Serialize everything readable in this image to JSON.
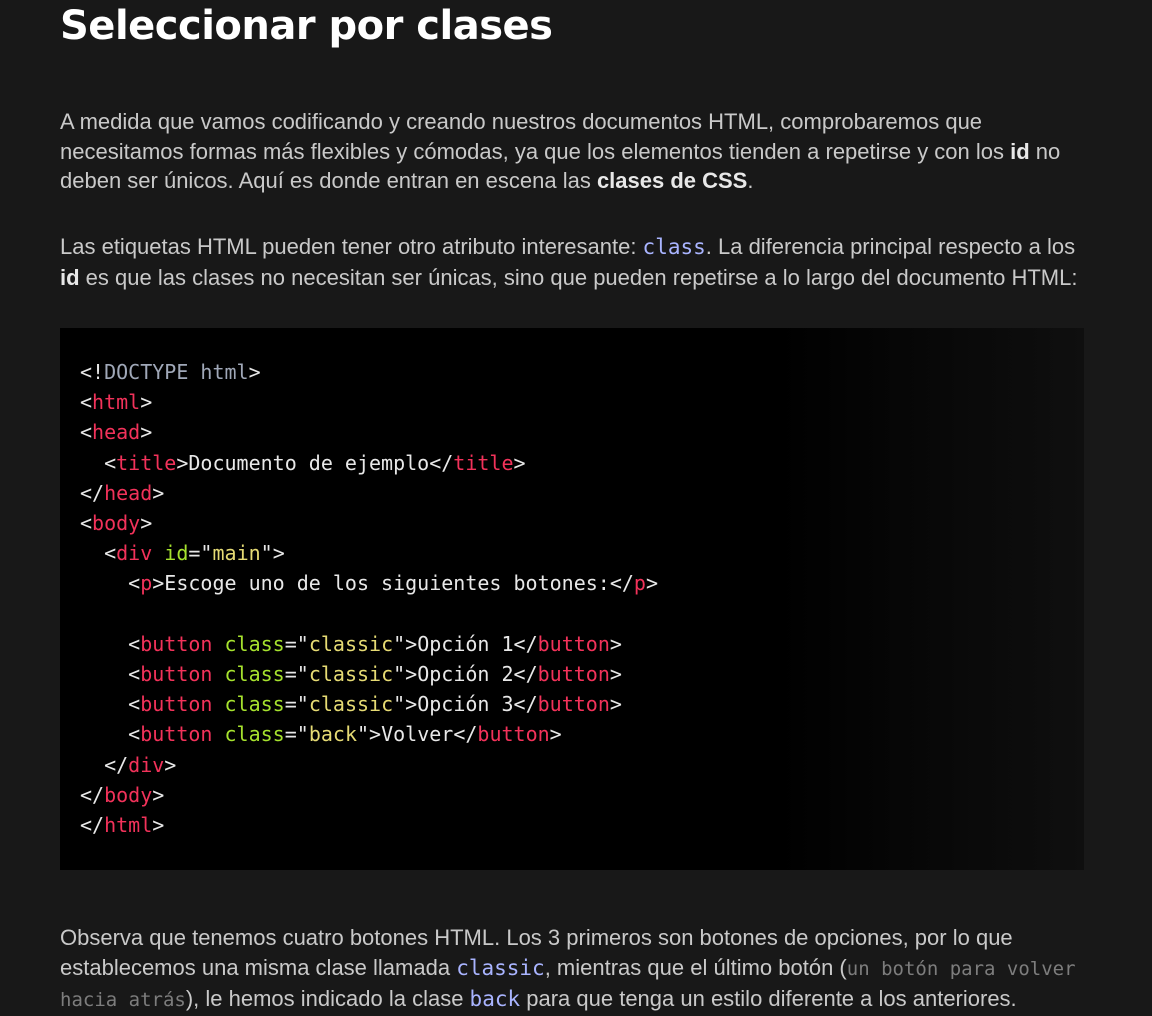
{
  "heading": "Seleccionar por clases",
  "intro": {
    "part1": "A medida que vamos codificando y creando nuestros documentos HTML, comprobaremos que necesitamos formas más flexibles y cómodas, ya que los elementos tienden a repetirse y con los ",
    "bold1": "id",
    "part2": " no deben ser únicos. Aquí es donde entran en escena las ",
    "bold2": "clases de CSS",
    "part3": "."
  },
  "second": {
    "part1": "Las etiquetas HTML pueden tener otro atributo interesante: ",
    "code": "class",
    "part2": ". La diferencia principal respecto a los ",
    "bold": "id",
    "part3": " es que las clases no necesitan ser únicas, sino que pueden repetirse a lo largo del documento HTML:"
  },
  "code_lines": [
    "<!DOCTYPE html>",
    "<html>",
    "<head>",
    "  <title>Documento de ejemplo</title>",
    "</head>",
    "<body>",
    "  <div id=\"main\">",
    "    <p>Escoge uno de los siguientes botones:</p>",
    "",
    "    <button class=\"classic\">Opción 1</button>",
    "    <button class=\"classic\">Opción 2</button>",
    "    <button class=\"classic\">Opción 3</button>",
    "    <button class=\"back\">Volver</button>",
    "  </div>",
    "</body>",
    "</html>"
  ],
  "third": {
    "part1": "Observa que tenemos cuatro botones HTML. Los 3 primeros son botones de opciones, por lo que establecemos una misma clase llamada ",
    "code1": "classic",
    "part2": ", mientras que el último botón (",
    "mono": "un botón para volver hacia atrás",
    "part3": "), le hemos indicado la clase ",
    "code2": "back",
    "part4": " para que tenga un estilo diferente a los anteriores."
  },
  "colors": {
    "background": "#181818",
    "code_background": "#000000",
    "tag": "#f2325a",
    "attr": "#a6e22e",
    "value": "#e6db74",
    "inline_code": "#a9b4ff"
  }
}
